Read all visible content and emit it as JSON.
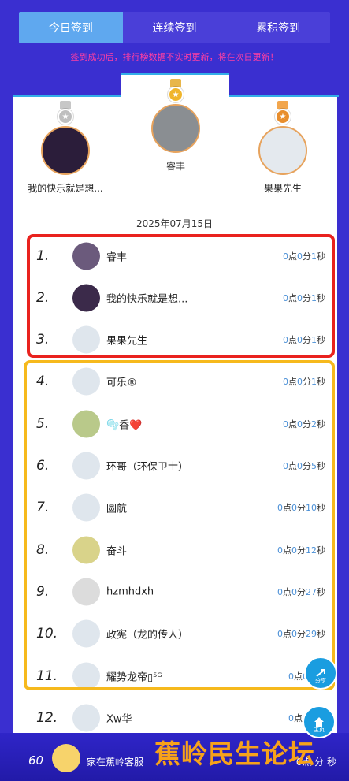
{
  "tabs": [
    {
      "label": "今日签到",
      "active": true
    },
    {
      "label": "连续签到",
      "active": false
    },
    {
      "label": "累积签到",
      "active": false
    }
  ],
  "notice": "签到成功后，排行榜数据不实时更新，将在次日更新！",
  "podium": [
    {
      "name": "我的快乐就是想...",
      "medal": "silver"
    },
    {
      "name": "睿丰",
      "medal": "gold"
    },
    {
      "name": "果果先生",
      "medal": "bronze"
    }
  ],
  "date": "2025年07月15日",
  "rows": [
    {
      "rank": "1.",
      "name": "睿丰",
      "h": "0",
      "m": "0",
      "s": "1"
    },
    {
      "rank": "2.",
      "name": "我的快乐就是想...",
      "h": "0",
      "m": "0",
      "s": "1"
    },
    {
      "rank": "3.",
      "name": "果果先生",
      "h": "0",
      "m": "0",
      "s": "1"
    },
    {
      "rank": "4.",
      "name": "可乐®",
      "h": "0",
      "m": "0",
      "s": "1"
    },
    {
      "rank": "5.",
      "name": "🫧香❤️",
      "h": "0",
      "m": "0",
      "s": "2"
    },
    {
      "rank": "6.",
      "name": "环哥（环保卫士）",
      "h": "0",
      "m": "0",
      "s": "5"
    },
    {
      "rank": "7.",
      "name": "圆航",
      "h": "0",
      "m": "0",
      "s": "10"
    },
    {
      "rank": "8.",
      "name": "奋斗",
      "h": "0",
      "m": "0",
      "s": "12"
    },
    {
      "rank": "9.",
      "name": "hzmhdxh",
      "h": "0",
      "m": "0",
      "s": "27"
    },
    {
      "rank": "10.",
      "name": "政宪（龙的传人）",
      "h": "0",
      "m": "0",
      "s": "29"
    },
    {
      "rank": "11.",
      "name": "耀势龙帝▯⁵ᴳ",
      "h": "0",
      "m": "0",
      "s": ""
    },
    {
      "rank": "12.",
      "name": "Xw华",
      "h": "0",
      "m": "0",
      "s": ""
    }
  ],
  "labels": {
    "h": "点",
    "m": "分",
    "s": "秒"
  },
  "footer": {
    "rank": "60",
    "name": "家在蕉岭客服",
    "time": "6点 分 秒"
  },
  "watermark": "蕉岭民生论坛",
  "float": {
    "share": "分享",
    "home": "主页"
  }
}
